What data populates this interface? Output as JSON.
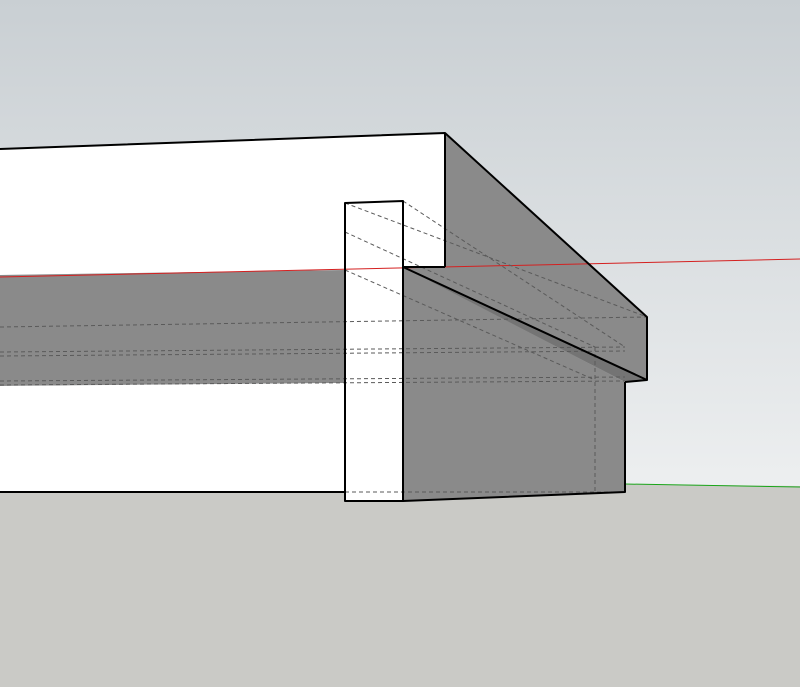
{
  "app": {
    "view": "3d-model-viewport",
    "projection": "perspective"
  },
  "colors": {
    "sky_top": "#c9cfd3",
    "sky_bottom": "#edeff0",
    "ground": "#cacac6",
    "face_light": "#ffffff",
    "face_shaded": "#8a8a8a",
    "face_dark": "#747474",
    "edge": "#000000",
    "hidden_edge": "#5a5a5a",
    "axis_red": "#d42020",
    "axis_green": "#1aa51a"
  },
  "axes": [
    {
      "name": "red-axis",
      "color_key": "axis_red"
    },
    {
      "name": "green-axis",
      "color_key": "axis_green"
    }
  ],
  "model": {
    "objects": [
      "slab",
      "wall",
      "overhang"
    ],
    "hidden_lines": true
  }
}
